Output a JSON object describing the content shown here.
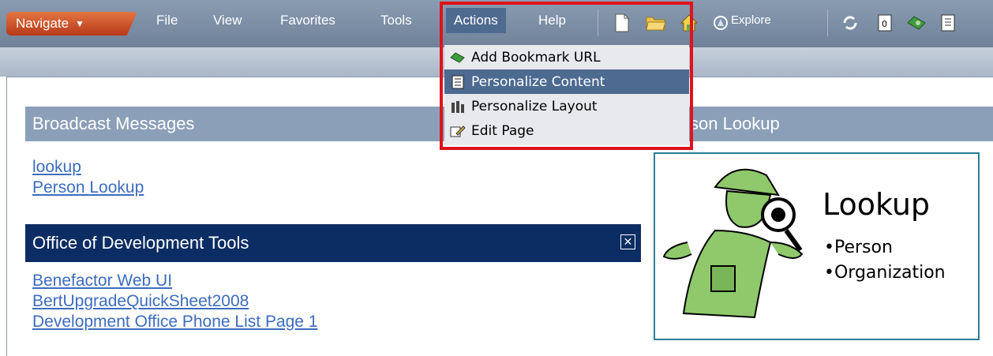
{
  "toolbar": {
    "navigate_label": "Navigate",
    "menus": [
      "File",
      "View",
      "Favorites",
      "Tools",
      "Actions",
      "Help"
    ],
    "explore_label": "Explore"
  },
  "actions_menu": {
    "items": [
      "Add Bookmark URL",
      "Personalize Content",
      "Personalize Layout",
      "Edit Page"
    ],
    "selected": "Personalize Content"
  },
  "broadcast": {
    "title": "Broadcast Messages",
    "links": [
      "lookup",
      "Person Lookup"
    ]
  },
  "dev_tools": {
    "title": "Office of Development Tools",
    "links": [
      "Benefactor Web UI",
      "BertUpgradeQuickSheet2008",
      "Development Office Phone List Page 1"
    ]
  },
  "person_lookup": {
    "title": "son Lookup",
    "graphic_title": "Lookup",
    "graphic_items": [
      "•Person",
      "•Organization"
    ]
  },
  "colors": {
    "accent_red": "#e0121b",
    "header_dark": "#0c2d63",
    "header_light": "#8b9fb8",
    "link": "#3c6cbf"
  }
}
